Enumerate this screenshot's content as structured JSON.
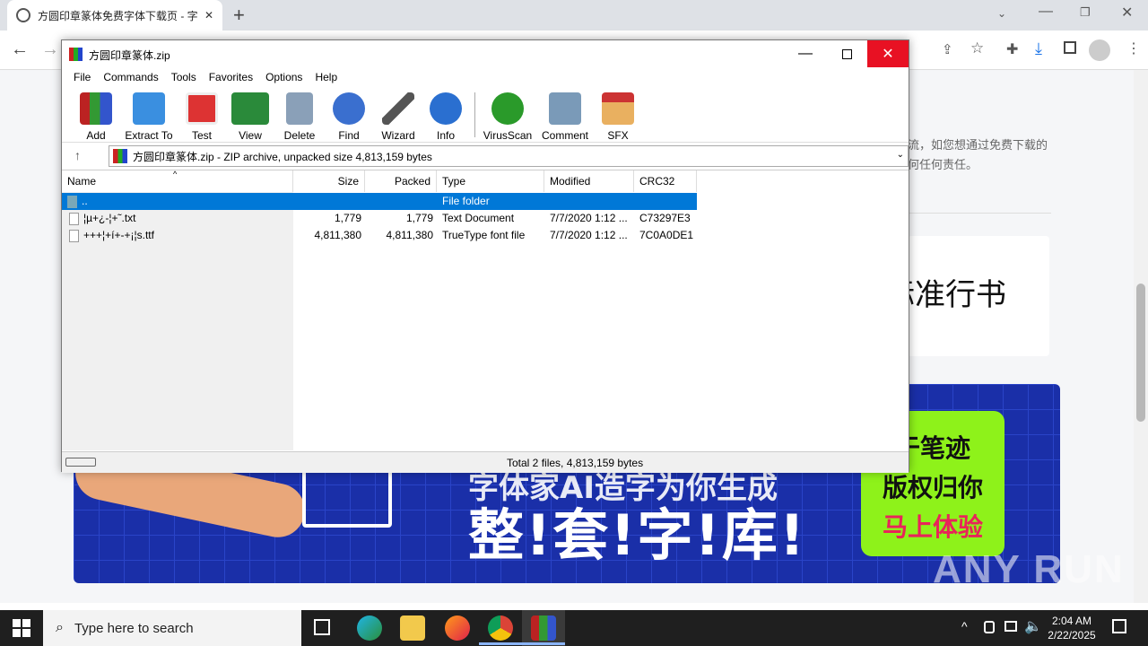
{
  "browser": {
    "tab_title": "方圆印章篆体免费字体下载页 - 字",
    "tab_close": "✕",
    "new_tab": "+",
    "web_text": "流，如您想通过免费下载的 何任何责任。",
    "font_preview": "你标准行书"
  },
  "banner": {
    "line1": "字体家AI造字为你生成",
    "line2": "整!套!字!库!",
    "side1": "于笔迹",
    "side2": "版权归你",
    "side3": "马上体验",
    "watermark": "ANY RUN"
  },
  "winrar": {
    "title": "方圆印章篆体.zip",
    "menus": [
      "File",
      "Commands",
      "Tools",
      "Favorites",
      "Options",
      "Help"
    ],
    "tools": [
      {
        "label": "Add",
        "icon": "add-icon"
      },
      {
        "label": "Extract To",
        "icon": "extract-folder-icon"
      },
      {
        "label": "Test",
        "icon": "test-clipboard-icon"
      },
      {
        "label": "View",
        "icon": "book-icon"
      },
      {
        "label": "Delete",
        "icon": "trash-icon"
      },
      {
        "label": "Find",
        "icon": "magnifier-icon"
      },
      {
        "label": "Wizard",
        "icon": "wand-icon"
      },
      {
        "label": "Info",
        "icon": "info-icon"
      },
      {
        "label": "VirusScan",
        "icon": "virus-icon"
      },
      {
        "label": "Comment",
        "icon": "comment-icon"
      },
      {
        "label": "SFX",
        "icon": "sfx-box-icon"
      }
    ],
    "address": "方圆印章篆体.zip - ZIP archive, unpacked size 4,813,159 bytes",
    "columns": [
      "Name",
      "Size",
      "Packed",
      "Type",
      "Modified",
      "CRC32"
    ],
    "rows": [
      {
        "name": "..",
        "size": "",
        "packed": "",
        "type": "File folder",
        "modified": "",
        "crc": ""
      },
      {
        "name": "¦µ+¿-¦+˜.txt",
        "size": "1,779",
        "packed": "1,779",
        "type": "Text Document",
        "modified": "7/7/2020 1:12 ...",
        "crc": "C73297E3"
      },
      {
        "name": "+++¦+í+-+¡¦s.ttf",
        "size": "4,811,380",
        "packed": "4,811,380",
        "type": "TrueType font file",
        "modified": "7/7/2020 1:12 ...",
        "crc": "7C0A0DE1"
      }
    ],
    "status": "Total 2 files, 4,813,159 bytes"
  },
  "taskbar": {
    "search_placeholder": "Type here to search",
    "time": "2:04 AM",
    "date": "2/22/2025"
  }
}
